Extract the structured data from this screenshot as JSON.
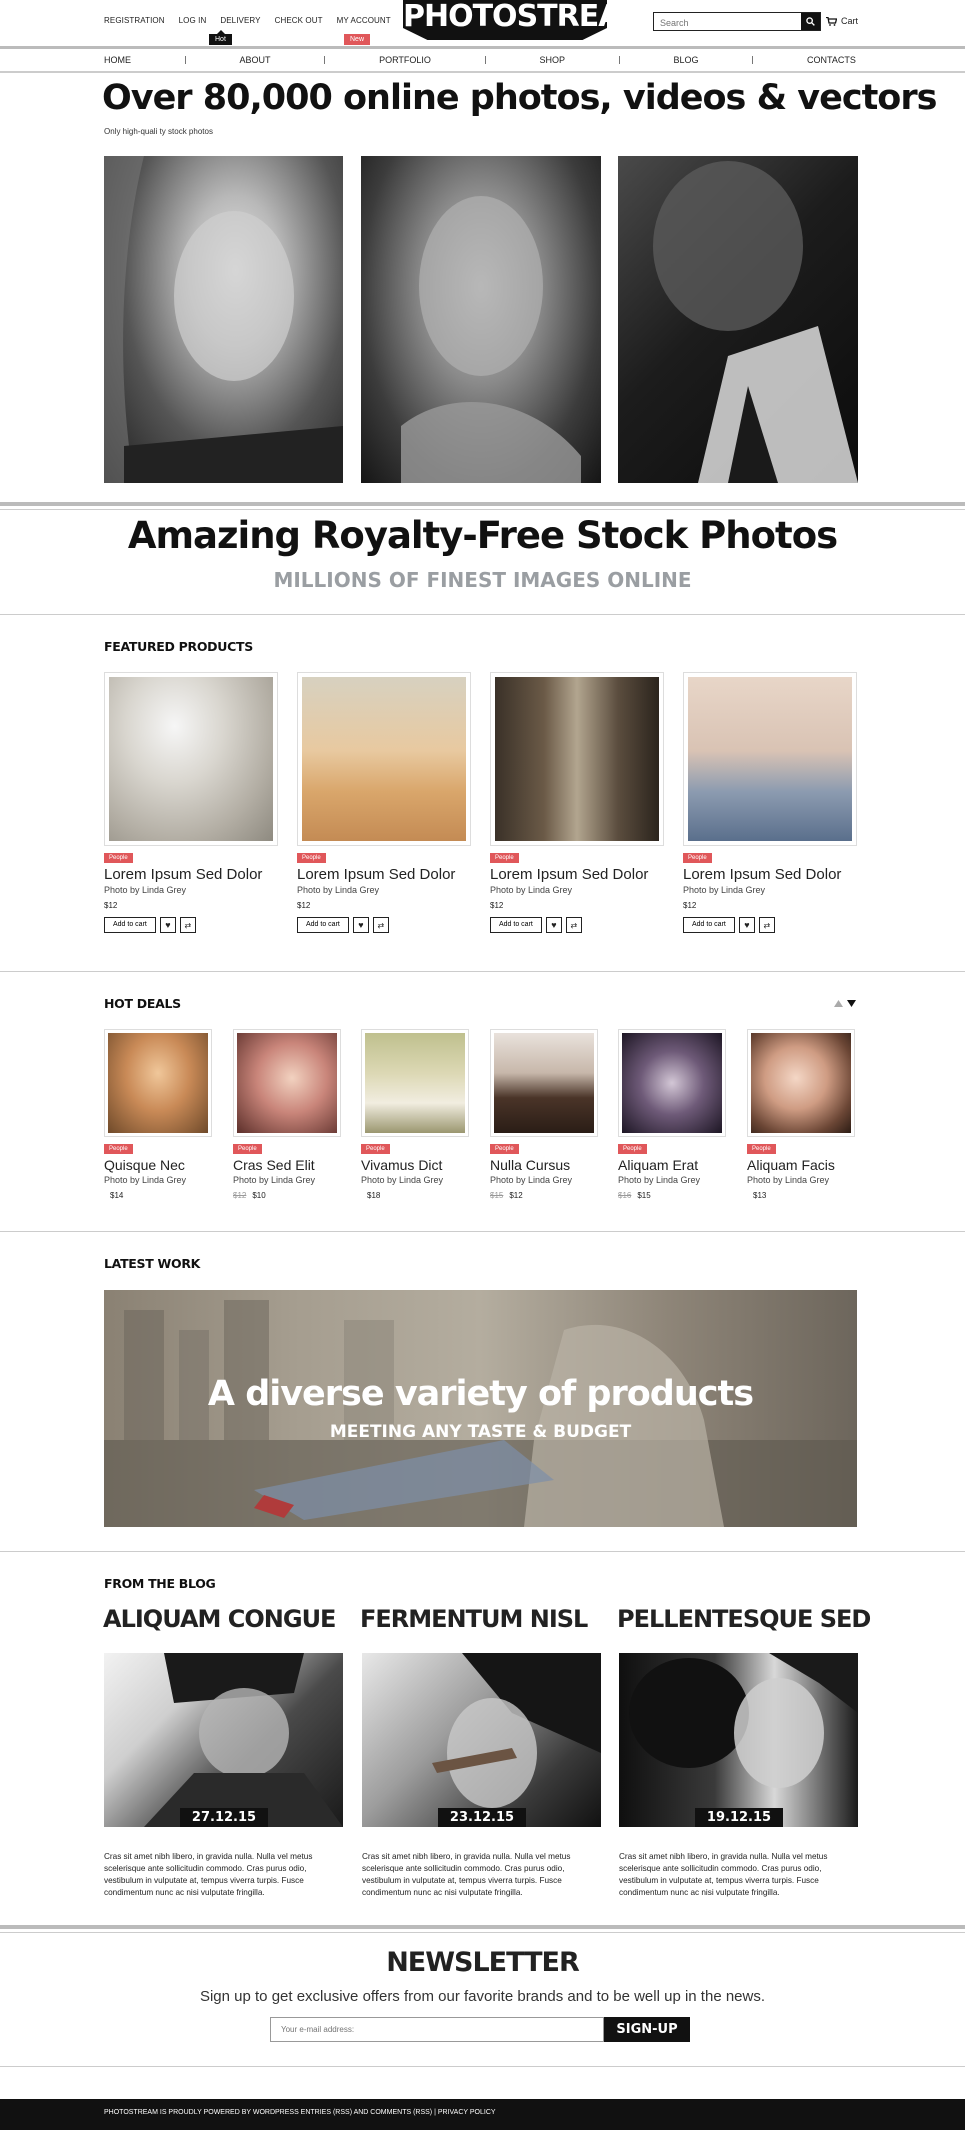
{
  "header": {
    "top_links": [
      "Registration",
      "Log In",
      "Delivery",
      "Check Out",
      "My Account"
    ],
    "hot_badge": "Hot",
    "new_badge": "New",
    "logo": "PHOTOSTREAM",
    "search_placeholder": "Search",
    "cart_label": "Cart"
  },
  "nav": {
    "items": [
      "HOME",
      "ABOUT",
      "PORTFOLIO",
      "SHOP",
      "BLOG",
      "CONTACTS"
    ]
  },
  "hero": {
    "title": "Over 80,000 online photos, videos & vectors",
    "subtitle": "Only high-quali    ty stock photos"
  },
  "promo": {
    "title": "Amazing Royalty-Free Stock Photos",
    "subtitle": "MILLIONS OF FINEST IMAGES ONLINE",
    "subtitle_color": "#9a9ea2"
  },
  "featured": {
    "heading": "FEATURED PRODUCTS",
    "tag_color": "#e0575a",
    "products": [
      {
        "tag": "People",
        "name": "Lorem Ipsum Sed Dolor",
        "by": "Photo by Linda Grey",
        "price": "$12",
        "cart_label": "Add to cart"
      },
      {
        "tag": "People",
        "name": "Lorem Ipsum Sed Dolor",
        "by": "Photo by Linda Grey",
        "price": "$12",
        "cart_label": "Add to cart"
      },
      {
        "tag": "People",
        "name": "Lorem Ipsum Sed Dolor",
        "by": "Photo by Linda Grey",
        "price": "$12",
        "cart_label": "Add to cart"
      },
      {
        "tag": "People",
        "name": "Lorem Ipsum Sed Dolor",
        "by": "Photo by Linda Grey",
        "price": "$12",
        "cart_label": "Add to cart"
      }
    ]
  },
  "hot_deals": {
    "heading": "HOT DEALS",
    "items": [
      {
        "tag": "People",
        "name": "Quisque Nec",
        "by": "Photo by Linda Grey",
        "old_price": "",
        "price": "$14"
      },
      {
        "tag": "People",
        "name": "Cras Sed Elit",
        "by": "Photo by Linda Grey",
        "old_price": "$12",
        "price": "$10"
      },
      {
        "tag": "People",
        "name": "Vivamus Dict",
        "by": "Photo by Linda Grey",
        "old_price": "",
        "price": "$18"
      },
      {
        "tag": "People",
        "name": "Nulla Cursus",
        "by": "Photo by Linda Grey",
        "old_price": "$15",
        "price": "$12"
      },
      {
        "tag": "People",
        "name": "Aliquam Erat",
        "by": "Photo by Linda Grey",
        "old_price": "$16",
        "price": "$15"
      },
      {
        "tag": "People",
        "name": "Aliquam Facis",
        "by": "Photo by Linda Grey",
        "old_price": "",
        "price": "$13"
      }
    ]
  },
  "latest": {
    "heading": "LATEST WORK",
    "banner_title": "A diverse variety of products",
    "banner_subtitle": "MEETING ANY TASTE & BUDGET"
  },
  "blog": {
    "heading": "FROM THE BLOG",
    "posts": [
      {
        "title": "ALIQUAM CONGUE",
        "date": "27.12.15",
        "text": "Cras sit amet nibh libero, in gravida nulla. Nulla vel metus scelerisque ante sollicitudin commodo. Cras purus odio, vestibulum in vulputate at, tempus viverra turpis. Fusce condimentum nunc ac nisi vulputate fringilla."
      },
      {
        "title": "FERMENTUM NISL",
        "date": "23.12.15",
        "text": "Cras sit amet nibh libero, in gravida nulla. Nulla vel metus scelerisque ante sollicitudin commodo. Cras purus odio, vestibulum in vulputate at, tempus viverra turpis. Fusce condimentum nunc ac nisi vulputate fringilla."
      },
      {
        "title": "PELLENTESQUE SED",
        "date": "19.12.15",
        "text": "Cras sit amet nibh libero, in gravida nulla. Nulla vel metus scelerisque ante sollicitudin commodo. Cras purus odio, vestibulum in vulputate at, tempus viverra turpis. Fusce condimentum nunc ac nisi vulputate fringilla."
      }
    ]
  },
  "newsletter": {
    "title": "NEWSLETTER",
    "subtitle": "Sign up to get exclusive offers from our favorite brands and to be well up in the news.",
    "placeholder": "Your e-mail address:",
    "button": "SIGN-UP"
  },
  "footer": {
    "text": "PHOTOSTREAM IS PROUDLY POWERED BY WORDPRESS ENTRIES (RSS) AND COMMENTS (RSS)  |  PRIVACY POLICY"
  }
}
